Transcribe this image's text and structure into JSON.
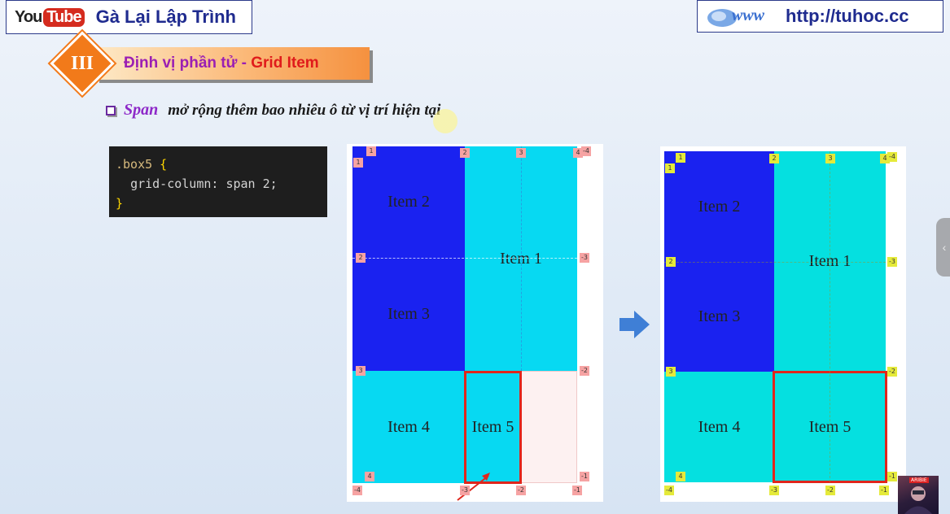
{
  "header": {
    "youtube_you": "You",
    "youtube_tube": "Tube",
    "channel_name": "Gà Lại Lập Trình",
    "www_logo": "www",
    "site_url": "http://tuhoc.cc"
  },
  "section": {
    "number": "III",
    "title_part1": "Định vị phần tử - ",
    "title_part2": "Grid Item"
  },
  "bullet": {
    "keyword": "Span",
    "text": "mở rộng thêm bao nhiêu ô từ vị trí hiện tại"
  },
  "code": {
    "selector": ".box5",
    "open_brace": " {",
    "property": "grid-column",
    "value": ": span 2;",
    "close_brace": "}"
  },
  "grid_before": {
    "items": [
      "Item 2",
      "Item 1",
      "Item 3",
      "Item 4",
      "Item 5"
    ],
    "top_tags": [
      "1",
      "2",
      "3",
      "4",
      "-4"
    ],
    "left_tags": [
      "1",
      "2",
      "3",
      "4"
    ],
    "right_tags": [
      "-3",
      "-2",
      "-1"
    ],
    "bottom_tags": [
      "-4",
      "-3",
      "-2",
      "-1"
    ]
  },
  "grid_after": {
    "items": [
      "Item 2",
      "Item 1",
      "Item 3",
      "Item 4",
      "Item 5"
    ],
    "top_tags": [
      "1",
      "2",
      "3",
      "4",
      "-4"
    ],
    "left_tags": [
      "1",
      "2",
      "3",
      "4"
    ],
    "right_tags": [
      "-3",
      "-2",
      "-1"
    ],
    "bottom_tags": [
      "-4",
      "-3",
      "-2",
      "-1"
    ]
  },
  "icons": {
    "next_arrow": "arrow-right-icon",
    "side_tab": "chevron-left-icon"
  },
  "avatar": {
    "badge": "ARIBIE"
  },
  "colors": {
    "item_blue": "#1a22f0",
    "item_cyan": "#07d9f2",
    "highlight_red": "#e0261c",
    "title_purple": "#9b1fb3"
  }
}
